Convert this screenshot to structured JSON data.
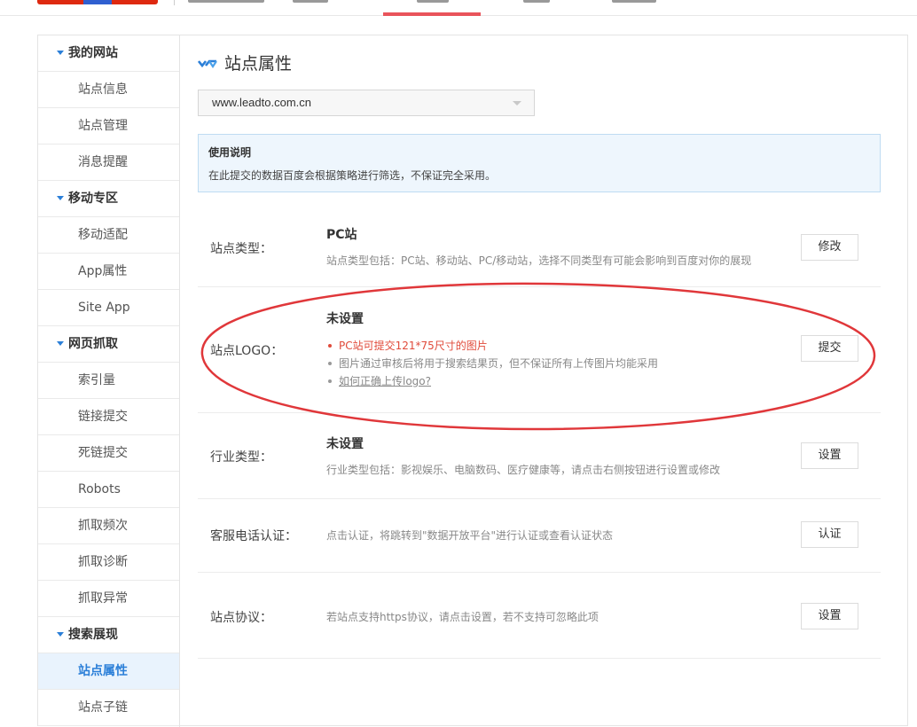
{
  "sidebar": {
    "groups": [
      {
        "label": "我的网站",
        "items": [
          "站点信息",
          "站点管理",
          "消息提醒"
        ]
      },
      {
        "label": "移动专区",
        "items": [
          "移动适配",
          "App属性",
          "Site App"
        ]
      },
      {
        "label": "网页抓取",
        "items": [
          "索引量",
          "链接提交",
          "死链提交",
          "Robots",
          "抓取频次",
          "抓取诊断",
          "抓取异常"
        ]
      },
      {
        "label": "搜索展现",
        "items": [
          "站点属性",
          "站点子链"
        ]
      }
    ],
    "active_item": "站点属性"
  },
  "main": {
    "title": "站点属性",
    "site_select": {
      "value": "www.leadto.com.cn"
    },
    "notice": {
      "title": "使用说明",
      "text": "在此提交的数据百度会根据策略进行筛选，不保证完全采用。"
    },
    "rows": [
      {
        "label": "站点类型：",
        "value": "PC站",
        "desc": "站点类型包括：PC站、移动站、PC/移动站，选择不同类型有可能会影响到百度对你的展现",
        "button": "修改"
      },
      {
        "label": "站点LOGO：",
        "value": "未设置",
        "bullets": [
          "PC站可提交121*75尺寸的图片",
          "图片通过审核后将用于搜索结果页，但不保证所有上传图片均能采用",
          "如何正确上传logo?"
        ],
        "button": "提交"
      },
      {
        "label": "行业类型：",
        "value": "未设置",
        "desc": "行业类型包括：影视娱乐、电脑数码、医疗健康等，请点击右侧按钮进行设置或修改",
        "button": "设置"
      },
      {
        "label": "客服电话认证：",
        "desc": "点击认证，将跳转到\"数据开放平台\"进行认证或查看认证状态",
        "button": "认证"
      },
      {
        "label": "站点协议：",
        "desc": "若站点支持https协议，请点击设置，若不支持可忽略此项",
        "button": "设置"
      }
    ]
  },
  "colors": {
    "accent_blue": "#2b7fd8",
    "annotation_red": "#e0373a",
    "tab_underline": "#e9545b",
    "notice_bg": "#eef6fd"
  }
}
